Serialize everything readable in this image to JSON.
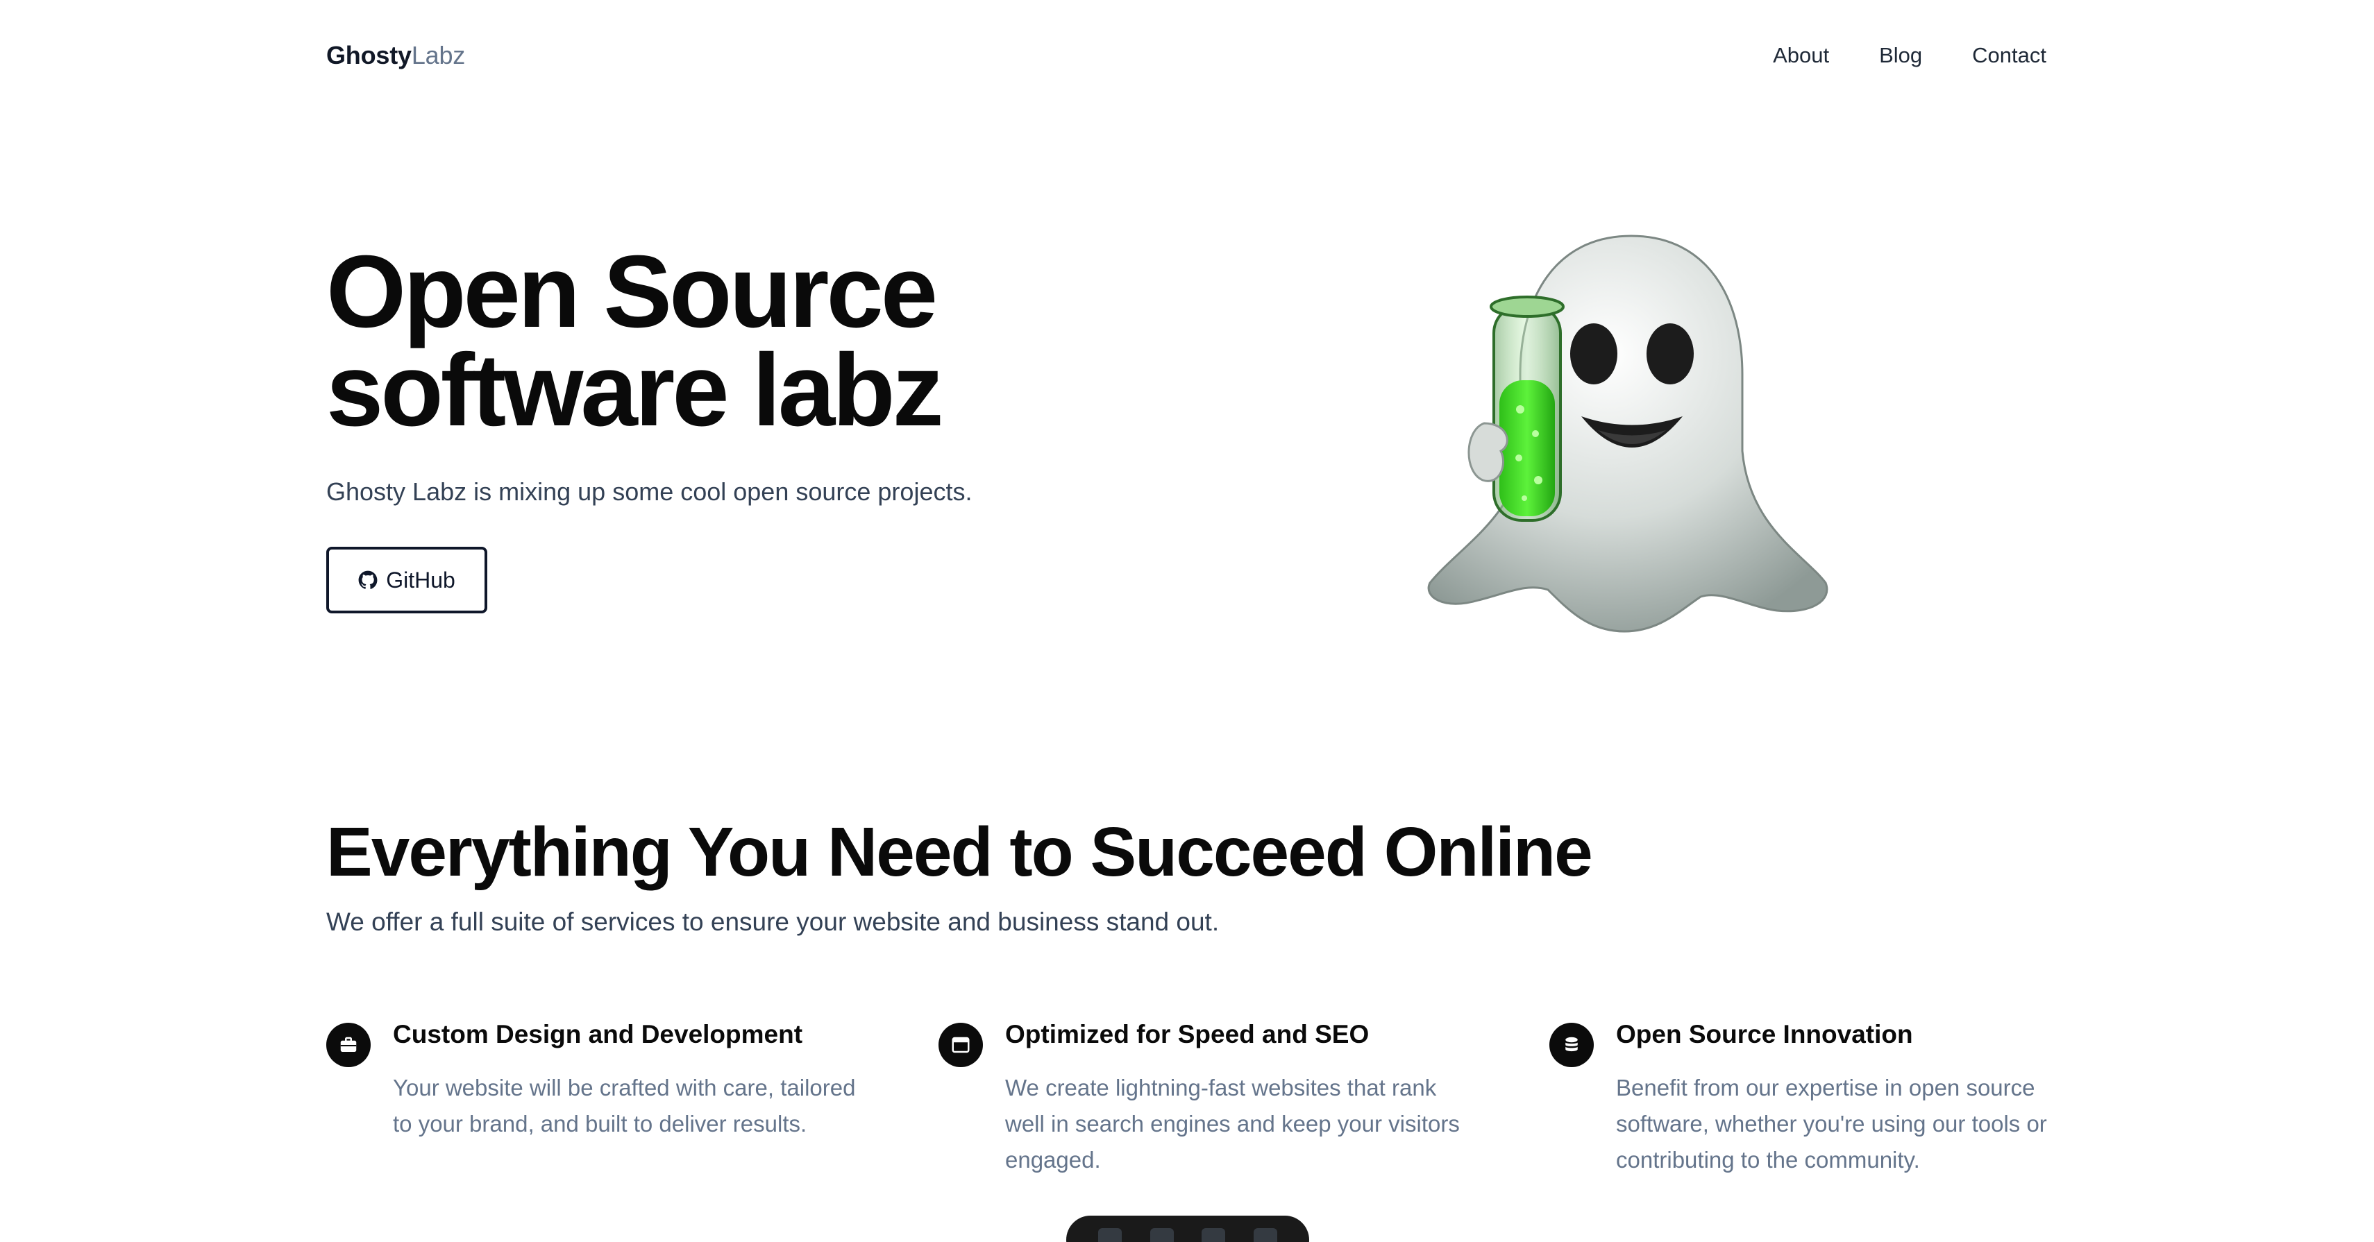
{
  "header": {
    "brand_primary": "Ghosty",
    "brand_secondary": "Labz",
    "nav": [
      {
        "label": "About"
      },
      {
        "label": "Blog"
      },
      {
        "label": "Contact"
      }
    ]
  },
  "hero": {
    "title_line1": "Open Source",
    "title_line2": "software labz",
    "subtitle": "Ghosty Labz is mixing up some cool open source projects.",
    "github_button_label": "GitHub",
    "mascot_icon": "ghost-with-test-tube-icon"
  },
  "services": {
    "title": "Everything You Need to Succeed Online",
    "subtitle": "We offer a full suite of services to ensure your website and business stand out.",
    "features": [
      {
        "title": "Custom Design and Development",
        "description": "Your website will be crafted with care, tailored to your brand, and built to deliver results.",
        "icon": "briefcase-icon"
      },
      {
        "title": "Optimized for Speed and SEO",
        "description": "We create lightning-fast websites that rank well in search engines and keep your visitors engaged.",
        "icon": "browser-window-icon"
      },
      {
        "title": "Open Source Innovation",
        "description": "Benefit from our expertise in open source software, whether you're using our tools or contributing to the community.",
        "icon": "database-icon"
      }
    ]
  },
  "colors": {
    "text_primary": "#0a0a0a",
    "text_secondary": "#334155",
    "text_muted": "#64748b",
    "icon_bg": "#0b0b0b",
    "dock_bg": "#1a1a1a"
  }
}
